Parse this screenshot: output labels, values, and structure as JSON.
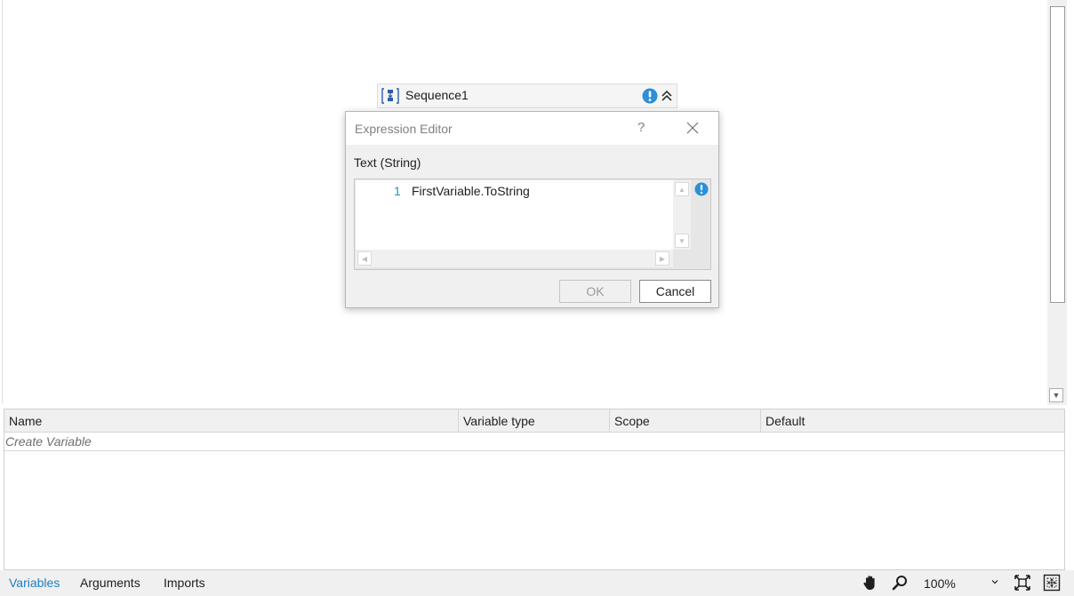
{
  "designer": {
    "sequence": {
      "title": "Sequence1",
      "icon": "sequence-icon",
      "warning_icon": "warning-icon",
      "collapse_icon": "collapse-up-icon"
    }
  },
  "dialog": {
    "title": "Expression Editor",
    "help": "?",
    "label": "Text (String)",
    "line_number": "1",
    "code": "FirstVariable.ToString",
    "ok_label": "OK",
    "cancel_label": "Cancel",
    "ok_enabled": false
  },
  "variables": {
    "columns": [
      "Name",
      "Variable type",
      "Scope",
      "Default"
    ],
    "create_placeholder": "Create Variable"
  },
  "bottombar": {
    "tabs": [
      "Variables",
      "Arguments",
      "Imports"
    ],
    "active_tab": "Variables",
    "zoom": "100%"
  },
  "colors": {
    "accent": "#1e7fc3",
    "warning": "#2d8fd5",
    "line_number": "#2b91af"
  }
}
